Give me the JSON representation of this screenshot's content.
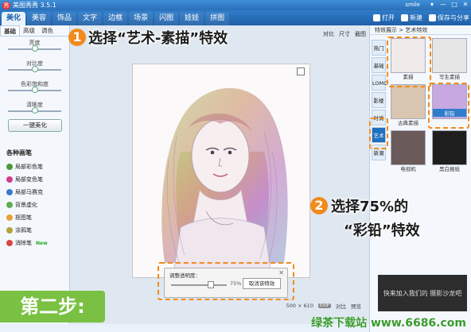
{
  "window": {
    "title": "美图秀秀 3.5.1",
    "user": "smile",
    "controls": [
      "▾",
      "—",
      "□",
      "✕"
    ]
  },
  "tabs": [
    "美化",
    "美容",
    "饰品",
    "文字",
    "边框",
    "场景",
    "闪图",
    "娃娃",
    "拼图"
  ],
  "active_tab": 0,
  "actions": {
    "open": "打开",
    "new": "新建",
    "save": "保存与分享"
  },
  "left_panel": {
    "subtabs": [
      "基础",
      "高级",
      "调色"
    ],
    "sliders": [
      {
        "label": "亮度",
        "value": 0.5
      },
      {
        "label": "对比度",
        "value": 0.5
      },
      {
        "label": "色彩饱和度",
        "value": 0.5
      },
      {
        "label": "清晰度",
        "value": 0.5
      }
    ],
    "one_click": "一键美化",
    "brush_title": "各种画笔",
    "brushes": [
      {
        "label": "局部彩色笔",
        "color": "#4a9a3a"
      },
      {
        "label": "局部变色笔",
        "color": "#d23c8a"
      },
      {
        "label": "局部马赛克",
        "color": "#3a7ac9"
      },
      {
        "label": "背景虚化",
        "color": "#5fae4e"
      },
      {
        "label": "抠图笔",
        "color": "#e5a13a"
      },
      {
        "label": "涂鸦笔",
        "color": "#b5a03a"
      },
      {
        "label": "消除笔",
        "color": "#d44",
        "badge": "New"
      }
    ]
  },
  "canvas": {
    "tools": [
      "对比",
      "尺寸",
      "截图"
    ],
    "transparency_dialog": {
      "title": "调整透明度：",
      "close": "✕",
      "value_label": "75%",
      "value": 0.75,
      "button": "取消该特效"
    },
    "status": {
      "size": "500 × 610",
      "badge": "EXIF",
      "compare": "对比",
      "preview": "预览"
    }
  },
  "right_panel": {
    "header": "特效展示 > 艺术特效",
    "categories": [
      "热门",
      "基础",
      "LOMO",
      "影楼",
      "时尚",
      "艺术",
      "新潮"
    ],
    "active_category": 5,
    "thumbnails": [
      {
        "label": "素描",
        "selected": false
      },
      {
        "label": "写生素描",
        "selected": false
      },
      {
        "label": "古典素描",
        "selected": false
      },
      {
        "label": "彩铅",
        "selected": true
      },
      {
        "label": "电视机",
        "selected": false
      },
      {
        "label": "黑白报纸",
        "selected": false
      }
    ],
    "ad_text": "快来加入我们的\n摄影沙龙吧"
  },
  "annotations": {
    "step1_num": "1",
    "step1_text": "选择“艺术-素描”特效",
    "step2_num": "2",
    "step2_text_line1": "选择75%的",
    "step2_text_line2": "“彩铅”特效",
    "color": "#f28a1c"
  },
  "footer": {
    "step_label": "第二步:",
    "watermark": "绿茶下载站 www.6686.com"
  }
}
